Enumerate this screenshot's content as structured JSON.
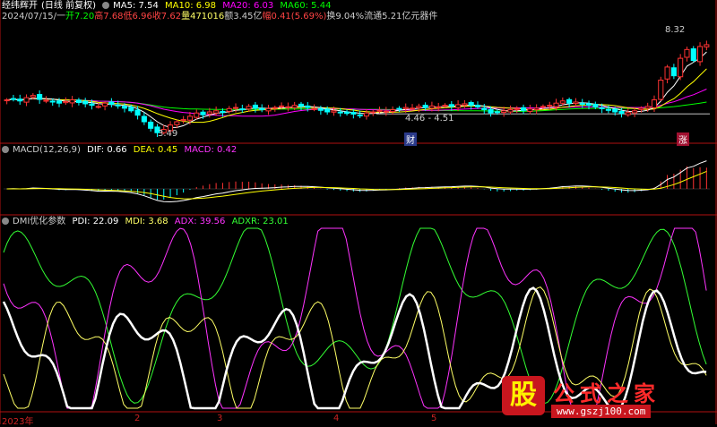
{
  "header": {
    "stock_name": "经纬辉开",
    "adjust": "(日线 前复权)",
    "ma": [
      {
        "label": "MA5: 7.54",
        "color": "#ffffff"
      },
      {
        "label": "MA10: 6.98",
        "color": "#ffff00"
      },
      {
        "label": "MA20: 6.03",
        "color": "#ff00ff"
      },
      {
        "label": "MA60: 5.44",
        "color": "#00ff00"
      }
    ],
    "info": {
      "date": "2024/07/15/一",
      "open": "开7.20",
      "high": "高7.68",
      "low": "低6.96",
      "close": "收7.62",
      "volume": "量471016",
      "amount": "额3.45亿",
      "change": "幅0.41(5.69%)",
      "turnover": "换9.04%",
      "float_cap": "流通5.21亿",
      "sector": "元器件"
    }
  },
  "macd_header": {
    "name": "MACD(12,26,9)",
    "dif": "DIF: 0.66",
    "dea": "DEA: 0.45",
    "macd": "MACD: 0.42"
  },
  "dmi_header": {
    "name": "DMI优化参数",
    "pdi": "PDI: 22.09",
    "mdi": "MDI: 3.68",
    "adx": "ADX: 39.56",
    "adxr": "ADXR: 23.01"
  },
  "annotations": {
    "high_price": "8.32",
    "low_price": "3.49",
    "range_label": "4.46 - 4.51",
    "tag_cai": "财",
    "tag_zhang": "涨"
  },
  "x_axis": {
    "labels": [
      "2023年",
      "2",
      "3",
      "4",
      "5"
    ]
  },
  "watermark": {
    "logo_char": "股",
    "title": "公式之家",
    "url": "www.gszj100.com"
  },
  "colors": {
    "up": "#ff3333",
    "down": "#00ffff",
    "ma5": "#ffffff",
    "ma10": "#ffff00",
    "ma20": "#ff00ff",
    "ma60": "#00ff00",
    "pdi": "#ffffff",
    "mdi": "#ffff66",
    "adx": "#ff33ff",
    "adxr": "#33ff33",
    "divider": "#b01010"
  },
  "chart_data": [
    {
      "type": "candlestick",
      "title": "经纬辉开 (日线 前复权)",
      "close": [
        5.1,
        5.15,
        5.05,
        5.2,
        5.3,
        5.12,
        5.08,
        5.0,
        4.95,
        5.02,
        5.1,
        4.98,
        4.92,
        4.85,
        4.8,
        4.95,
        4.9,
        4.85,
        4.72,
        4.6,
        4.4,
        4.1,
        3.8,
        3.6,
        3.75,
        3.95,
        4.1,
        4.2,
        4.35,
        4.5,
        4.42,
        4.55,
        4.6,
        4.52,
        4.7,
        4.75,
        4.68,
        4.8,
        4.72,
        4.65,
        4.7,
        4.75,
        4.82,
        4.78,
        4.85,
        4.8,
        4.75,
        4.7,
        4.62,
        4.55,
        4.6,
        4.52,
        4.48,
        4.45,
        4.4,
        4.5,
        4.55,
        4.62,
        4.58,
        4.65,
        4.7,
        4.75,
        4.72,
        4.8,
        4.75,
        4.82,
        4.78,
        4.85,
        4.8,
        4.88,
        4.92,
        4.85,
        4.78,
        4.65,
        4.5,
        4.55,
        4.6,
        4.65,
        4.7,
        4.62,
        4.68,
        4.72,
        4.8,
        4.85,
        4.95,
        5.05,
        4.95,
        5.0,
        4.9,
        4.85,
        4.78,
        4.7,
        4.62,
        4.55,
        4.48,
        4.52,
        4.6,
        4.72,
        4.8,
        5.1,
        6.0,
        6.6,
        6.2,
        7.0,
        7.4,
        6.9,
        7.54,
        7.62
      ],
      "ma5_last": 7.54,
      "ma10_last": 6.98,
      "ma20_last": 6.03,
      "ma60_last": 5.44,
      "high_marker": 8.32,
      "low_marker": 3.49,
      "ylim": [
        3.2,
        8.6
      ]
    },
    {
      "type": "macd",
      "dif_last": 0.66,
      "dea_last": 0.45,
      "macd_last": 0.42,
      "ylim": [
        -0.6,
        0.8
      ]
    },
    {
      "type": "line",
      "series_names": [
        "PDI",
        "MDI",
        "ADX",
        "ADXR"
      ],
      "last": [
        22.09,
        3.68,
        39.56,
        23.01
      ],
      "ylim": [
        0,
        100
      ]
    }
  ]
}
